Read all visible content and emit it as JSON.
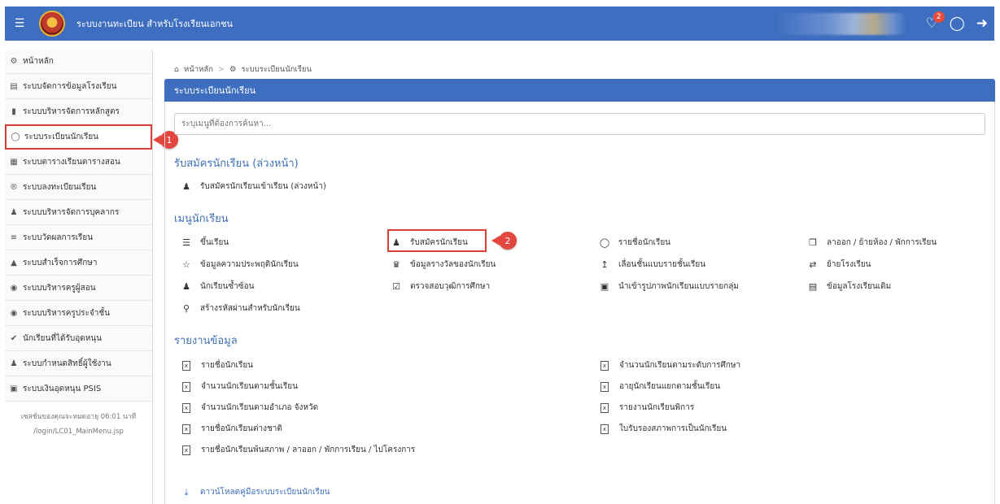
{
  "header": {
    "title": "ระบบงานทะเบียน สำหรับโรงเรียนเอกชน",
    "notification_count": "2"
  },
  "sidebar": {
    "items": [
      {
        "icon": "dashboard-icon",
        "label": "หน้าหลัก"
      },
      {
        "icon": "building-icon",
        "label": "ระบบจัดการข้อมูลโรงเรียน"
      },
      {
        "icon": "book-icon",
        "label": "ระบบบริหารจัดการหลักสูตร"
      },
      {
        "icon": "user-icon",
        "label": "ระบบระเบียนนักเรียน"
      },
      {
        "icon": "calendar-icon",
        "label": "ระบบตารางเรียนตารางสอน"
      },
      {
        "icon": "registered-icon",
        "label": "ระบบลงทะเบียนเรียน"
      },
      {
        "icon": "person-icon",
        "label": "ระบบบริหารจัดการบุคลากร"
      },
      {
        "icon": "list-icon",
        "label": "ระบบวัดผลการเรียน"
      },
      {
        "icon": "graduation-cap-icon",
        "label": "ระบบสำเร็จการศึกษา"
      },
      {
        "icon": "user-circle-icon",
        "label": "ระบบบริหารครูผู้สอน"
      },
      {
        "icon": "user-circle-icon",
        "label": "ระบบบริหารครูประจำชั้น"
      },
      {
        "icon": "check-circle-icon",
        "label": "นักเรียนที่ได้รับอุดหนุน"
      },
      {
        "icon": "users-icon",
        "label": "ระบบกำหนดสิทธิ์ผู้ใช้งาน"
      },
      {
        "icon": "money-icon",
        "label": "ระบบเงินอุดหนุน PSIS"
      }
    ],
    "session_note": "เซสชั่นของคุณจะหมดอายุ 06:01 นาที",
    "page_path": "/login/LC01_MainMenu.jsp"
  },
  "callouts": [
    "1",
    "2"
  ],
  "breadcrumb": {
    "home": "หน้าหลัก",
    "current": "ระบบระเบียนนักเรียน"
  },
  "panel": {
    "title": "ระบบระเบียนนักเรียน",
    "search_placeholder": "ระบุเมนูที่ต้องการค้นหา..."
  },
  "sections": {
    "pre_admission": {
      "title": "รับสมัครนักเรียน (ล่วงหน้า)",
      "items": [
        "รับสมัครนักเรียนเข้าเรียน (ล่วงหน้า)"
      ]
    },
    "student_menu": {
      "title": "เมนูนักเรียน",
      "items": [
        "ขึ้นเรียน",
        "รับสมัครนักเรียน",
        "รายชื่อนักเรียน",
        "ลาออก / ย้ายห้อง / พักการเรียน",
        "ข้อมูลความประพฤตินักเรียน",
        "ข้อมูลรางวัลของนักเรียน",
        "เลื่อนชั้นแบบรายชั้นเรียน",
        "ย้ายโรงเรียน",
        "นักเรียนซ้ำซ้อน",
        "ตรวจสอบวุฒิการศึกษา",
        "นำเข้ารูปภาพนักเรียนแบบรายกลุ่ม",
        "ข้อมูลโรงเรียนเดิม",
        "สร้างรหัสผ่านสำหรับนักเรียน"
      ]
    },
    "reports": {
      "title": "รายงานข้อมูล",
      "items": [
        "รายชื่อนักเรียน",
        "จำนวนนักเรียนตามระดับการศึกษา",
        "จำนวนนักเรียนตามชั้นเรียน",
        "อายุนักเรียนแยกตามชั้นเรียน",
        "จำนวนนักเรียนตามอำเภอ จังหวัด",
        "รายงานนักเรียนพิการ",
        "รายชื่อนักเรียนต่างชาติ",
        "ใบรับรองสภาพการเป็นนักเรียน",
        "รายชื่อนักเรียนพ้นสภาพ / ลาออก / พักการเรียน / ไปโครงการ"
      ]
    },
    "download": "ดาวน์โหลดคู่มือระบบระเบียนนักเรียน"
  }
}
